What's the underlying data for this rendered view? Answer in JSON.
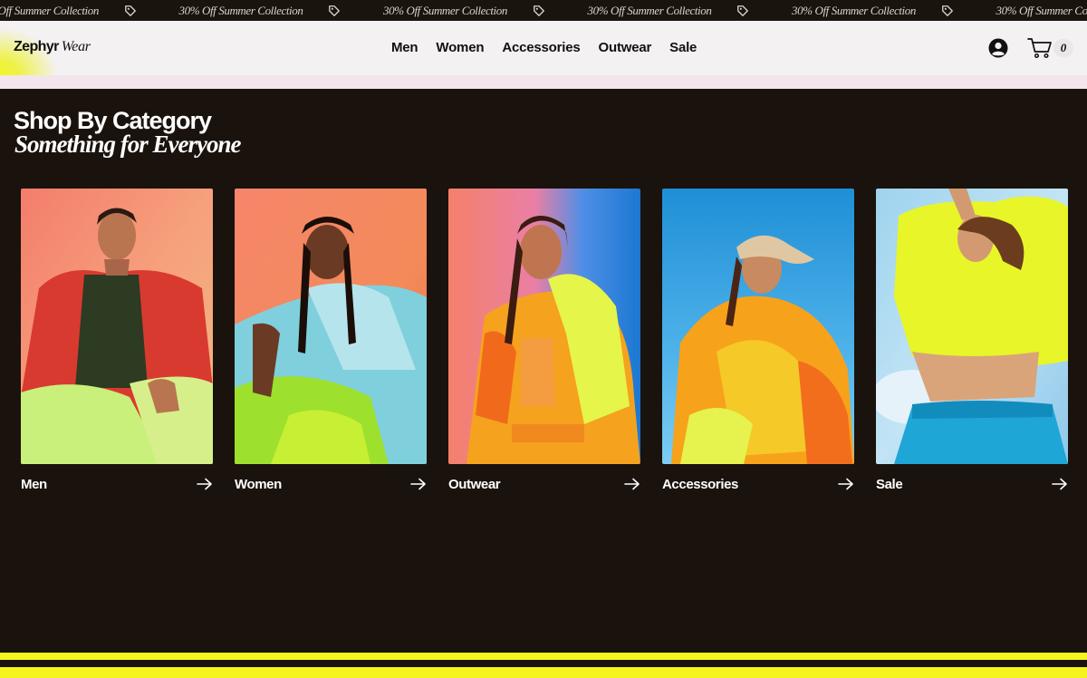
{
  "promo": {
    "text": "30% Off Summer Collection",
    "items": [
      "30% Off Summer Collection",
      "30% Off Summer Collection",
      "30% Off Summer Collection",
      "30% Off Summer Collection",
      "30% Off Summer Collection",
      "30% Off Summer Collection"
    ],
    "icon": "tag-icon"
  },
  "header": {
    "logo_bold": "Zephyr",
    "logo_italic": "Wear",
    "nav": [
      "Men",
      "Women",
      "Accessories",
      "Outwear",
      "Sale"
    ],
    "account_icon": "user-account-icon",
    "cart_icon": "shopping-cart-icon",
    "cart_count": "0"
  },
  "section": {
    "title": "Shop By Category",
    "subtitle": "Something for Everyone"
  },
  "categories": [
    {
      "label": "Men",
      "icon": "arrow-right-icon"
    },
    {
      "label": "Women",
      "icon": "arrow-right-icon"
    },
    {
      "label": "Outwear",
      "icon": "arrow-right-icon"
    },
    {
      "label": "Accessories",
      "icon": "arrow-right-icon"
    },
    {
      "label": "Sale",
      "icon": "arrow-right-icon"
    }
  ],
  "colors": {
    "background": "#1a120c",
    "header_bg": "#f4f1f3",
    "accent_yellow": "#f5f41e",
    "text_light": "#ffffff",
    "text_dark": "#111111"
  }
}
